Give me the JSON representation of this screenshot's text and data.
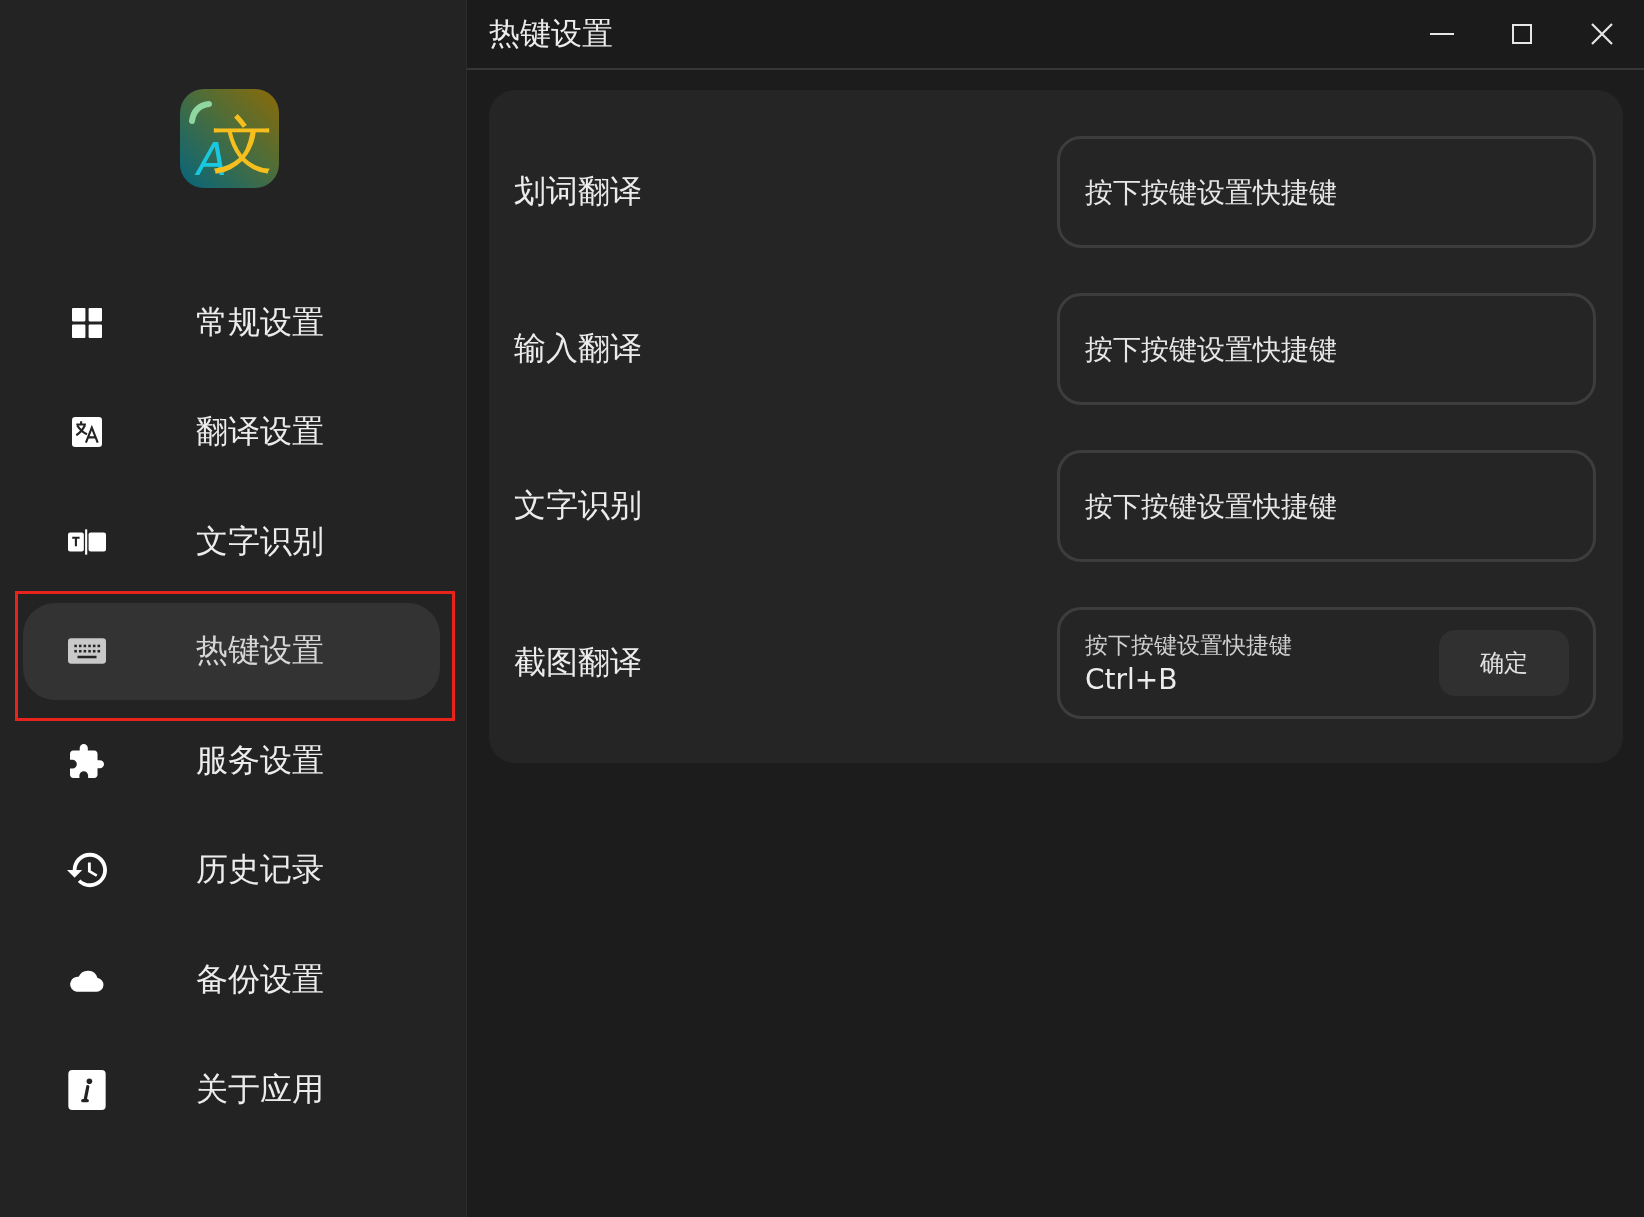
{
  "app_logo": {
    "glyph": "文",
    "letter": "A"
  },
  "sidebar": {
    "items": [
      {
        "label": "常规设置",
        "selected": false,
        "highlighted": false
      },
      {
        "label": "翻译设置",
        "selected": false,
        "highlighted": false
      },
      {
        "label": "文字识别",
        "selected": false,
        "highlighted": false
      },
      {
        "label": "热键设置",
        "selected": true,
        "highlighted": true
      },
      {
        "label": "服务设置",
        "selected": false,
        "highlighted": false
      },
      {
        "label": "历史记录",
        "selected": false,
        "highlighted": false
      },
      {
        "label": "备份设置",
        "selected": false,
        "highlighted": false
      },
      {
        "label": "关于应用",
        "selected": false,
        "highlighted": false
      }
    ]
  },
  "window": {
    "title": "热键设置"
  },
  "hotkeys": [
    {
      "label": "划词翻译",
      "placeholder": "按下按键设置快捷键"
    },
    {
      "label": "输入翻译",
      "placeholder": "按下按键设置快捷键"
    },
    {
      "label": "文字识别",
      "placeholder": "按下按键设置快捷键"
    },
    {
      "label": "截图翻译",
      "placeholder": "按下按键设置快捷键",
      "value": "Ctrl+B",
      "confirm_button": "确定"
    }
  ]
}
